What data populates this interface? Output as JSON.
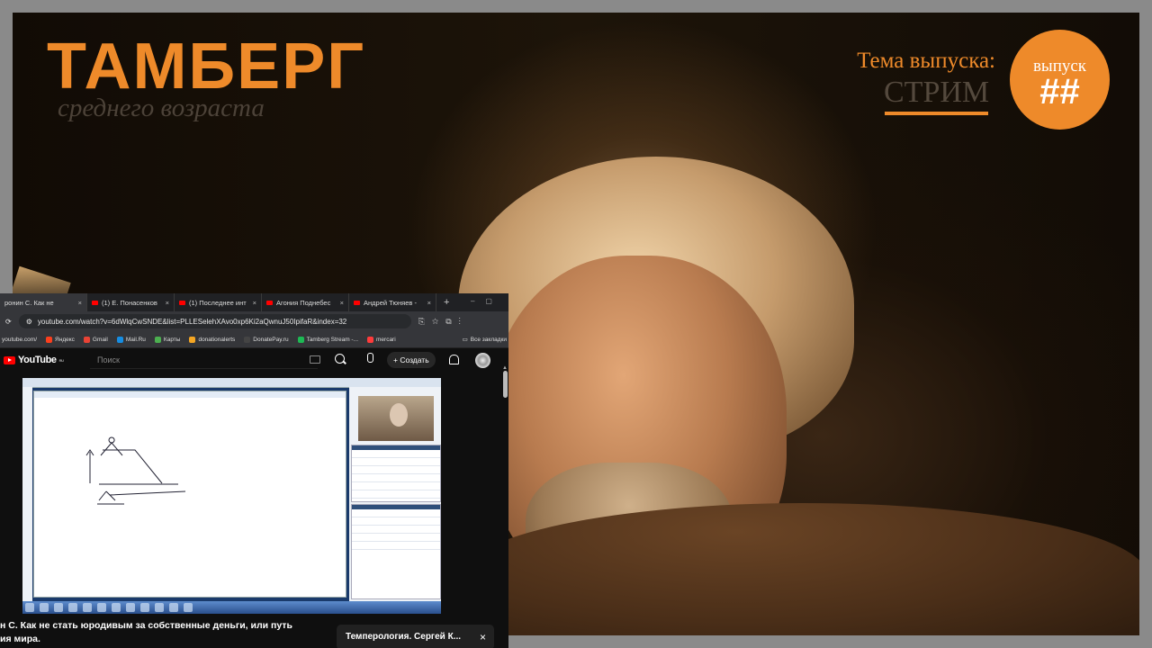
{
  "overlay": {
    "logo": "ТАМБЕРГ",
    "logo_sub": "среднего возраста",
    "topic_label": "Тема выпуска:",
    "topic_value": "СТРИМ",
    "badge_label": "выпуск",
    "badge_number": "##",
    "accent": "#ee8a2a"
  },
  "browser": {
    "tabs": [
      {
        "label": "ронин С. Как не"
      },
      {
        "label": "(1) Е. Понасенков"
      },
      {
        "label": "(1) Последнее инт"
      },
      {
        "label": "Агония Поднебес"
      },
      {
        "label": "Андрей Тюняев -"
      }
    ],
    "new_tab": "+",
    "url": "youtube.com/watch?v=6dWlqCwSNDE&list=PLLESelehXAvo0xp6Ki2aQwnuJ50IpifaR&index=32",
    "bookmarks": [
      {
        "label": "youtube.com/",
        "color": "#ff0000"
      },
      {
        "label": "Яндекс",
        "color": "#fc3f1d"
      },
      {
        "label": "Gmail",
        "color": "#ea4335"
      },
      {
        "label": "Mail.Ru",
        "color": "#168de2"
      },
      {
        "label": "Карты",
        "color": "#4caf50"
      },
      {
        "label": "donationalerts",
        "color": "#f5a623"
      },
      {
        "label": "DonatePay.ru",
        "color": "#444444"
      },
      {
        "label": "Tamberg Stream -...",
        "color": "#1db954"
      },
      {
        "label": "mercari",
        "color": "#ff3b3b"
      }
    ],
    "all_bookmarks": "Все закладки"
  },
  "youtube": {
    "logo": "YouTube",
    "region": "RU",
    "search_placeholder": "Поиск",
    "create_label": "+ Создать",
    "video_title_line1": "н С. Как не стать юродивым за собственные деньги, или путь",
    "video_title_line2": "ия мира.",
    "popup_text": "Темперология. Сергей К...",
    "popup_close": "×"
  }
}
